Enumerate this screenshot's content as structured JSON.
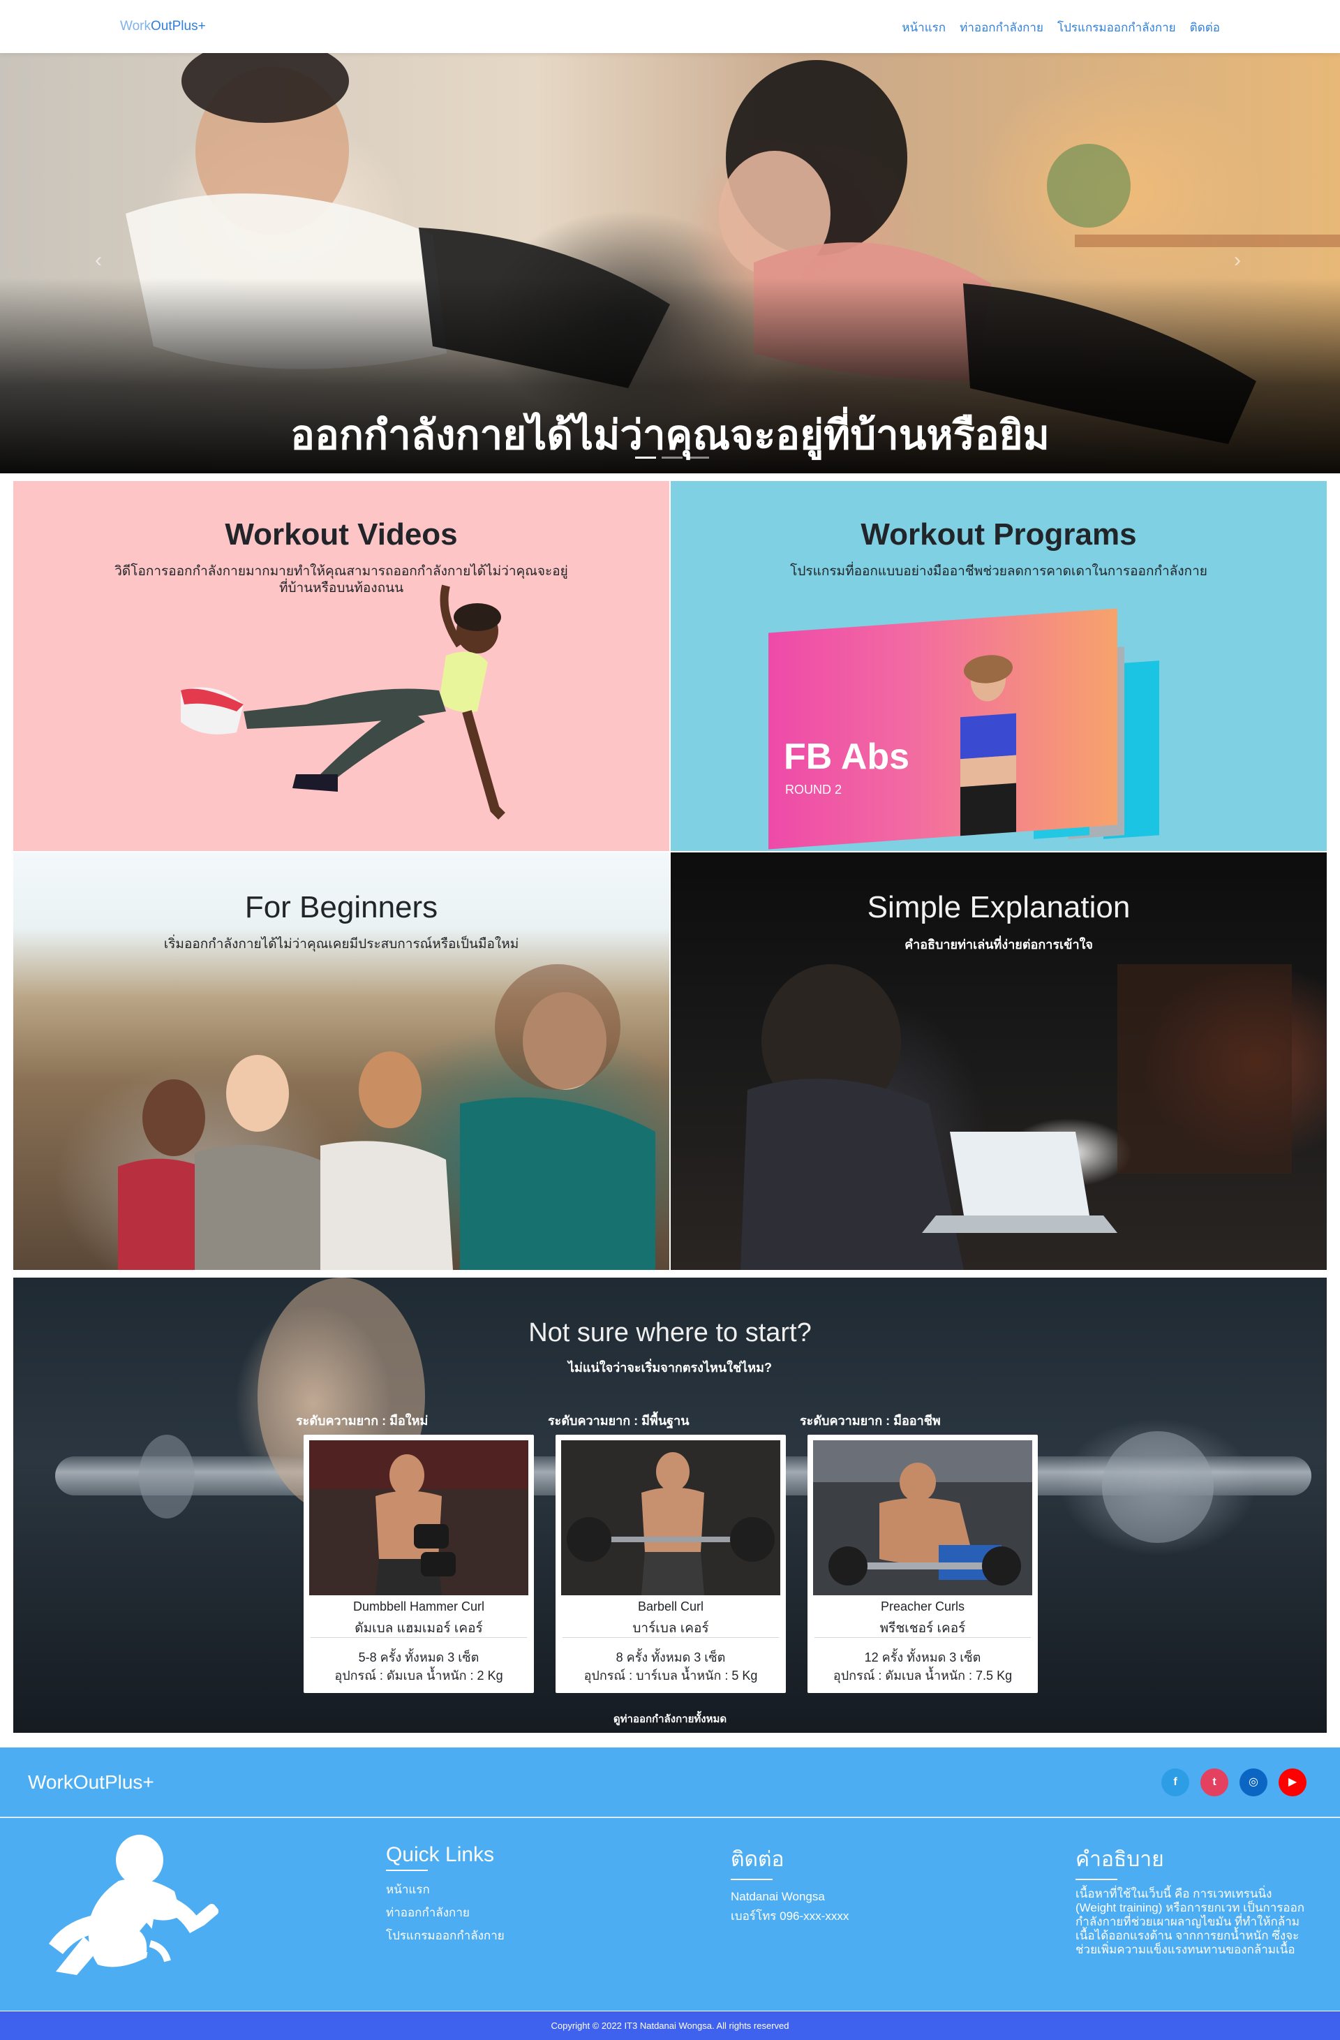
{
  "nav": {
    "brand_part1": "Work",
    "brand_part2": "OutPlus+",
    "links": [
      "หน้าแรก",
      "ท่าออกกำลังกาย",
      "โปรแกรมออกกำลังกาย",
      "ติดต่อ"
    ]
  },
  "hero": {
    "caption": "ออกกำลังกายได้ไม่ว่าคุณจะอยู่ที่บ้านหรือยิม",
    "slide_count": 3,
    "active_slide": 1
  },
  "features": [
    {
      "title": "Workout Videos",
      "description": "วิดีโอการออกกำลังกายมากมายทำให้คุณสามารถออกกำลังกายได้ไม่ว่าคุณจะอยู่ที่บ้านหรือบนท้องถนน"
    },
    {
      "title": "Workout Programs",
      "description": "โปรแกรมที่ออกแบบอย่างมืออาชีพช่วยลดการคาดเดาในการออกกำลังกาย",
      "image_text": "FB Abs",
      "image_subtext": "ROUND 2"
    },
    {
      "title": "For Beginners",
      "description": "เริ่มออกกำลังกายได้ไม่ว่าคุณเคยมีประสบการณ์หรือเป็นมือใหม่"
    },
    {
      "title": "Simple Explanation",
      "description": "คำอธิบายท่าเล่นที่ง่ายต่อการเข้าใจ"
    }
  ],
  "start": {
    "title": "Not sure where to start?",
    "subtitle": "ไม่แน่ใจว่าจะเริ่มจากตรงไหนใช่ไหม?",
    "see_all": "ดูท่าออกกำลังกายทั้งหมด",
    "exercises": [
      {
        "level": "ระดับความยาก : มือใหม่",
        "name_en": "Dumbbell Hammer Curl",
        "name_th": "ดัมเบล แฮมเมอร์ เคอร์",
        "reps": "5-8 ครั้ง ทั้งหมด 3 เซ็ต",
        "equipment": "อุปกรณ์ : ดัมเบล น้ำหนัก : 2 Kg"
      },
      {
        "level": "ระดับความยาก : มีพื้นฐาน",
        "name_en": "Barbell Curl",
        "name_th": "บาร์เบล เคอร์",
        "reps": "8 ครั้ง ทั้งหมด 3 เซ็ต",
        "equipment": "อุปกรณ์ : บาร์เบล น้ำหนัก : 5 Kg"
      },
      {
        "level": "ระดับความยาก : มืออาชีพ",
        "name_en": "Preacher Curls",
        "name_th": "พรีชเชอร์ เคอร์",
        "reps": "12 ครั้ง ทั้งหมด 3 เซ็ต",
        "equipment": "อุปกรณ์ : ดัมเบล น้ำหนัก : 7.5 Kg"
      }
    ]
  },
  "footer": {
    "brand": "WorkOutPlus+",
    "social": [
      {
        "icon": "facebook-icon",
        "glyph": "f",
        "color": "#3b5998"
      },
      {
        "icon": "twitter-icon",
        "glyph": "t",
        "color": "#e4405f"
      },
      {
        "icon": "instagram-icon",
        "glyph": "◎",
        "color": "#0a66c2"
      },
      {
        "icon": "youtube-icon",
        "glyph": "▶",
        "color": "#ff0000"
      }
    ],
    "quick_links_title": "Quick Links",
    "quick_links": [
      "หน้าแรก",
      "ท่าออกกำลังกาย",
      "โปรแกรมออกกำลังกาย"
    ],
    "contact_title": "ติดต่อ",
    "contact_name": "Natdanai Wongsa",
    "contact_phone": "เบอร์โทร 096-xxx-xxxx",
    "about_title": "คำอธิบาย",
    "about_text": "เนื้อหาที่ใช้ในเว็บนี้ คือ การเวทเทรนนิ่ง (Weight training) หรือการยกเวท เป็นการออกกำลังกายที่ช่วยเผาผลาญไขมัน ที่ทำให้กล้ามเนื้อได้ออกแรงต้าน จากการยกน้ำหนัก ซึ่งจะช่วยเพิ่มความแข็งแรงทนทานของกล้ามเนื้อ",
    "copyright": "Copyright © 2022 IT3 Natdanai Wongsa. All rights reserved"
  },
  "colors": {
    "nav_link": "#2f80dd",
    "card_pink": "#fec5c6",
    "card_cyan": "#7ed0e2",
    "footer_bg": "#4dadf2",
    "copyright_bg": "#3f62ee"
  }
}
